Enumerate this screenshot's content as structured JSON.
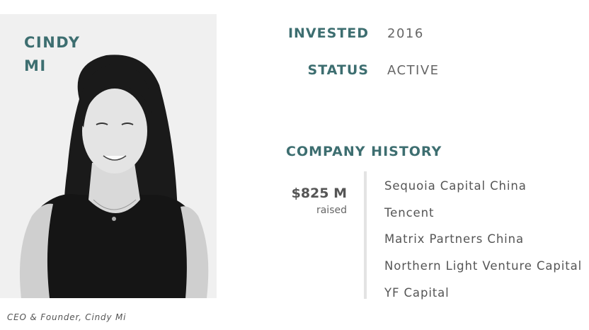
{
  "profile": {
    "name_line1": "CINDY",
    "name_line2": "MI",
    "caption": "CEO & Founder, Cindy Mi"
  },
  "invested": {
    "label": "INVESTED",
    "value": "2016"
  },
  "status": {
    "label": "STATUS",
    "value": "ACTIVE"
  },
  "history": {
    "title": "COMPANY HISTORY",
    "raised_amount": "$825 M",
    "raised_label": "raised",
    "investors": [
      "Sequoia Capital China",
      "Tencent",
      "Matrix Partners China",
      "Northern Light Venture Capital",
      "YF Capital"
    ]
  },
  "colors": {
    "accent": "#3d6e70",
    "text": "#555555",
    "divider": "#e3e3e3"
  }
}
